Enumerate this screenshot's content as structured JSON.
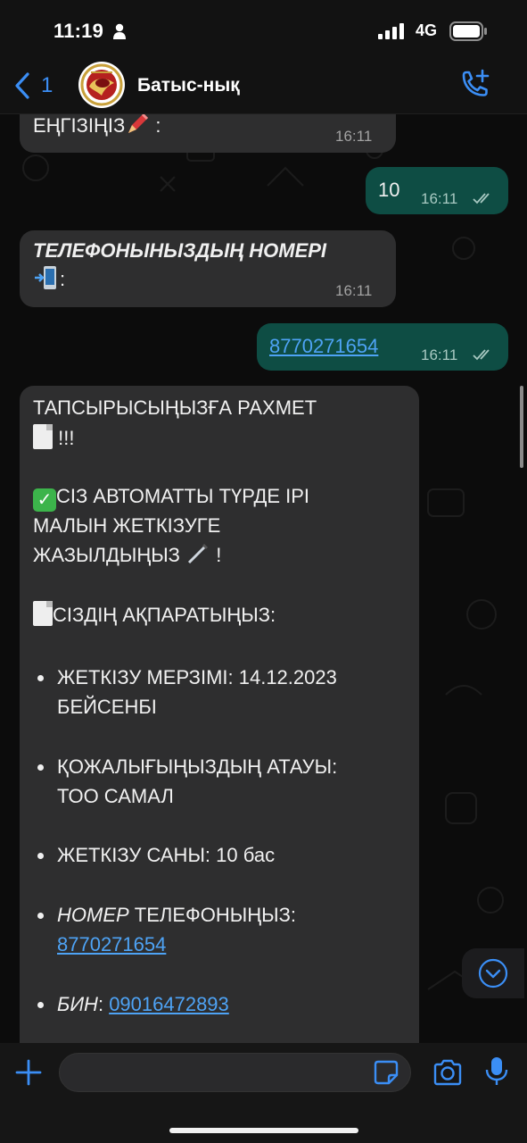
{
  "status_bar": {
    "time": "11:19",
    "network": "4G"
  },
  "header": {
    "back_count": "1",
    "contact_name": "Батыс-нық"
  },
  "messages": {
    "m1": {
      "text": "ЕҢГІЗІҢІЗ",
      "time": "16:11"
    },
    "m2": {
      "text": "10",
      "time": "16:11"
    },
    "m3": {
      "text": "ТЕЛЕФОНЫНЫЗДЫҢ НОМЕРІ",
      "suffix": ":",
      "time": "16:11"
    },
    "m4": {
      "link": "8770271654",
      "time": "16:11"
    },
    "m5": {
      "line1": "ТАПСЫРЫСЫҢЫЗҒА РАХМЕТ",
      "line2": "!!!",
      "line3": "СІЗ АВТОМАТТЫ ТҮРДЕ ІРІ",
      "line4": "МАЛЫН ЖЕТКІЗУГЕ",
      "line5": "ЖАЗЫЛДЫҢЫЗ",
      "line5_suffix": "!",
      "line6": "СІЗДІҢ АҚПАРАТЫҢЫЗ:",
      "b1_line1": "ЖЕТКІЗУ МЕРЗІМІ: 14.12.2023",
      "b1_line2": "БЕЙСЕНБІ",
      "b2_line1": "ҚОЖАЛЫҒЫҢЫЗДЫҢ АТАУЫ:",
      "b2_line2": "ТОО САМАЛ",
      "b3": "ЖЕТКІЗУ САНЫ: 10 бас",
      "b4_italic": "НОМЕР",
      "b4_rest": " ТЕЛЕФОНЫҢЫЗ:",
      "b4_link": "8770271654",
      "b5_italic": "БИН",
      "b5_sep": ": ",
      "b5_link": "09016472893"
    }
  },
  "composer": {
    "placeholder": ""
  },
  "colors": {
    "accent": "#3b8ef5",
    "incoming_bubble": "#2e2e2f",
    "outgoing_bubble": "#0e4d44",
    "link": "#4ea3f5"
  },
  "icons": [
    "person-icon",
    "signal-icon",
    "battery-icon",
    "chevron-left-icon",
    "add-call-icon",
    "double-check-icon",
    "pencil-emoji",
    "phone-arrow-emoji",
    "check-emoji",
    "document-emoji",
    "pen-emoji",
    "chevron-down-icon",
    "plus-icon",
    "sticker-icon",
    "camera-icon",
    "microphone-icon"
  ]
}
